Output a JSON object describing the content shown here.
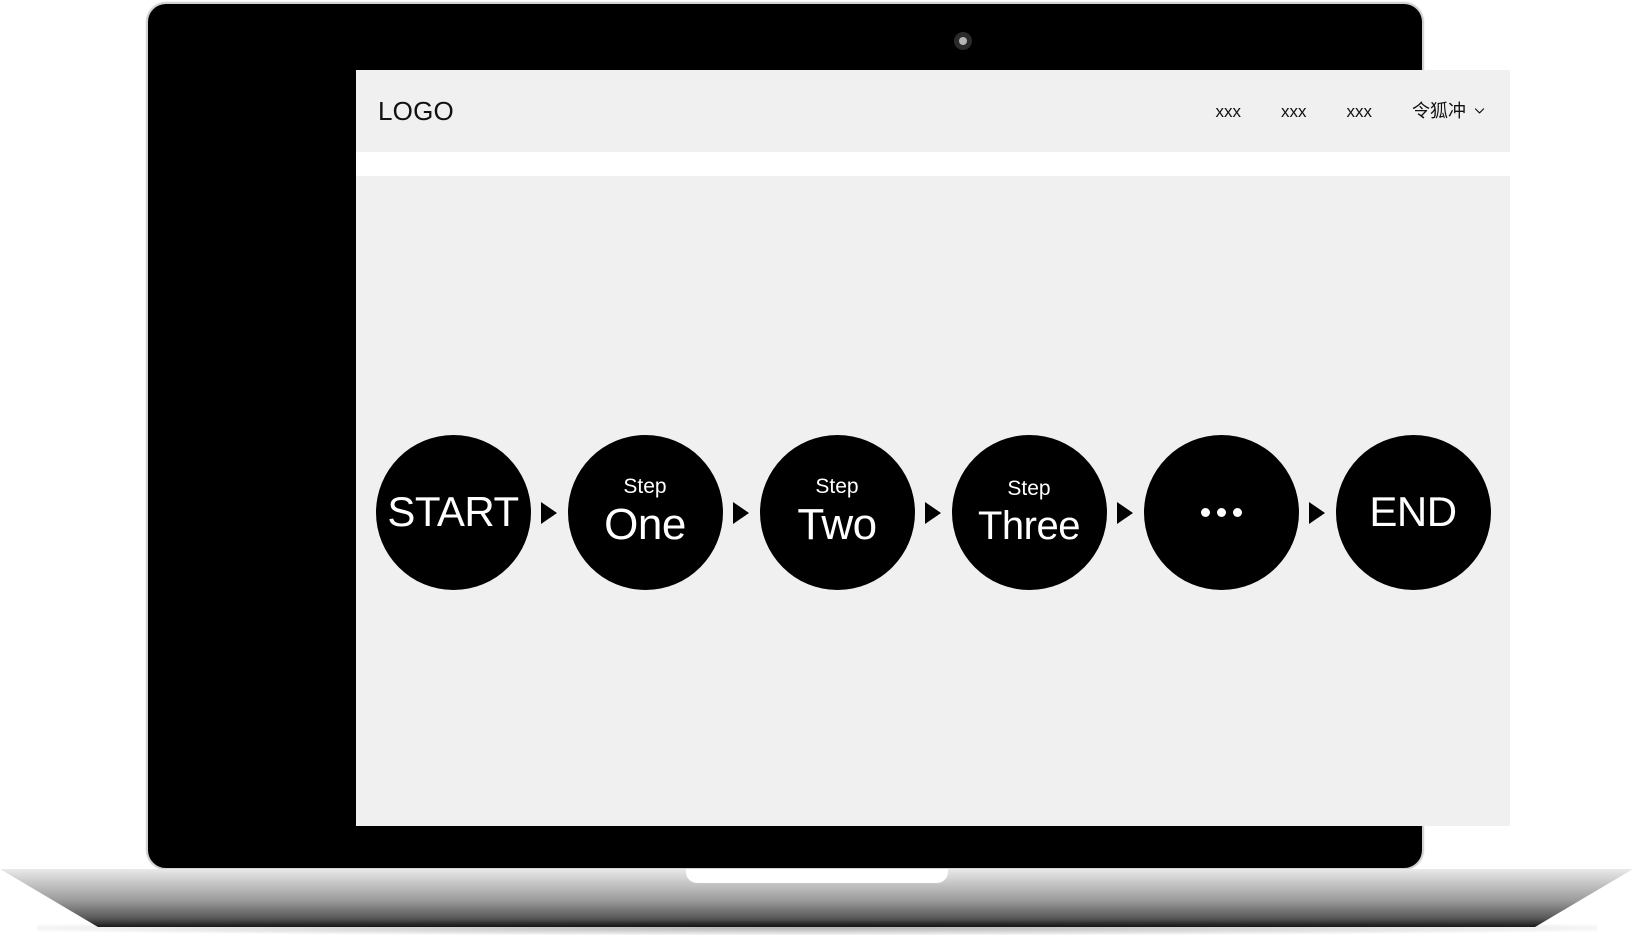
{
  "device": {
    "type": "laptop-mockup",
    "webcam": "webcam-dot",
    "bezel_color": "#000000",
    "frame_color": "#d2d2d2",
    "base_color": "#9a9a9a"
  },
  "site": {
    "background_color": "#f0f0f0",
    "divider_color": "#ffffff",
    "header": {
      "logo": "LOGO",
      "nav_items": [
        {
          "label": "xxx"
        },
        {
          "label": "xxx"
        },
        {
          "label": "xxx"
        }
      ],
      "user": {
        "name": "令狐冲",
        "chevron_icon": "chevron-down-icon"
      }
    },
    "main": {
      "flow": {
        "node_color": "#000000",
        "node_text_color": "#ffffff",
        "connector_icon": "triangle-right-icon",
        "nodes": [
          {
            "type": "terminal",
            "sub": "",
            "main": "START"
          },
          {
            "type": "step",
            "sub": "Step",
            "main": "One"
          },
          {
            "type": "step",
            "sub": "Step",
            "main": "Two"
          },
          {
            "type": "step",
            "sub": "Step",
            "main": "Three"
          },
          {
            "type": "ellipsis",
            "sub": "",
            "main": "···"
          },
          {
            "type": "terminal",
            "sub": "",
            "main": "END"
          }
        ]
      }
    }
  }
}
